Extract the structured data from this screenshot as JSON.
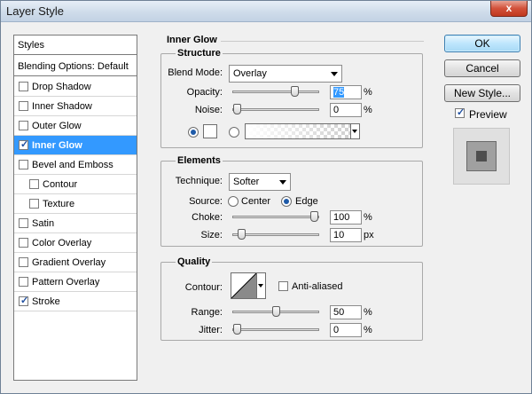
{
  "window": {
    "title": "Layer Style",
    "close_glyph": "x"
  },
  "styles_panel": {
    "header": "Styles",
    "blending_options": "Blending Options: Default",
    "items": [
      {
        "label": "Drop Shadow",
        "checked": false,
        "sub": false,
        "selected": false
      },
      {
        "label": "Inner Shadow",
        "checked": false,
        "sub": false,
        "selected": false
      },
      {
        "label": "Outer Glow",
        "checked": false,
        "sub": false,
        "selected": false
      },
      {
        "label": "Inner Glow",
        "checked": true,
        "sub": false,
        "selected": true
      },
      {
        "label": "Bevel and Emboss",
        "checked": false,
        "sub": false,
        "selected": false
      },
      {
        "label": "Contour",
        "checked": false,
        "sub": true,
        "selected": false
      },
      {
        "label": "Texture",
        "checked": false,
        "sub": true,
        "selected": false
      },
      {
        "label": "Satin",
        "checked": false,
        "sub": false,
        "selected": false
      },
      {
        "label": "Color Overlay",
        "checked": false,
        "sub": false,
        "selected": false
      },
      {
        "label": "Gradient Overlay",
        "checked": false,
        "sub": false,
        "selected": false
      },
      {
        "label": "Pattern Overlay",
        "checked": false,
        "sub": false,
        "selected": false
      },
      {
        "label": "Stroke",
        "checked": true,
        "sub": false,
        "selected": false
      }
    ]
  },
  "main": {
    "section_title": "Inner Glow",
    "structure": {
      "title": "Structure",
      "blend_mode_label": "Blend Mode:",
      "blend_mode_value": "Overlay",
      "opacity_label": "Opacity:",
      "opacity_value": "75",
      "opacity_unit": "%",
      "opacity_level": 0.75,
      "noise_label": "Noise:",
      "noise_value": "0",
      "noise_unit": "%",
      "noise_level": 0,
      "color_swatch": "#ffffff"
    },
    "elements": {
      "title": "Elements",
      "technique_label": "Technique:",
      "technique_value": "Softer",
      "source_label": "Source:",
      "source_center": "Center",
      "source_edge": "Edge",
      "choke_label": "Choke:",
      "choke_value": "100",
      "choke_unit": "%",
      "choke_level": 1.0,
      "size_label": "Size:",
      "size_value": "10",
      "size_unit": "px"
    },
    "quality": {
      "title": "Quality",
      "contour_label": "Contour:",
      "anti_aliased_label": "Anti-aliased",
      "range_label": "Range:",
      "range_value": "50",
      "range_unit": "%",
      "range_level": 0.5,
      "jitter_label": "Jitter:",
      "jitter_value": "0",
      "jitter_unit": "%",
      "jitter_level": 0
    }
  },
  "buttons": {
    "ok": "OK",
    "cancel": "Cancel",
    "new_style": "New Style...",
    "preview_label": "Preview"
  }
}
